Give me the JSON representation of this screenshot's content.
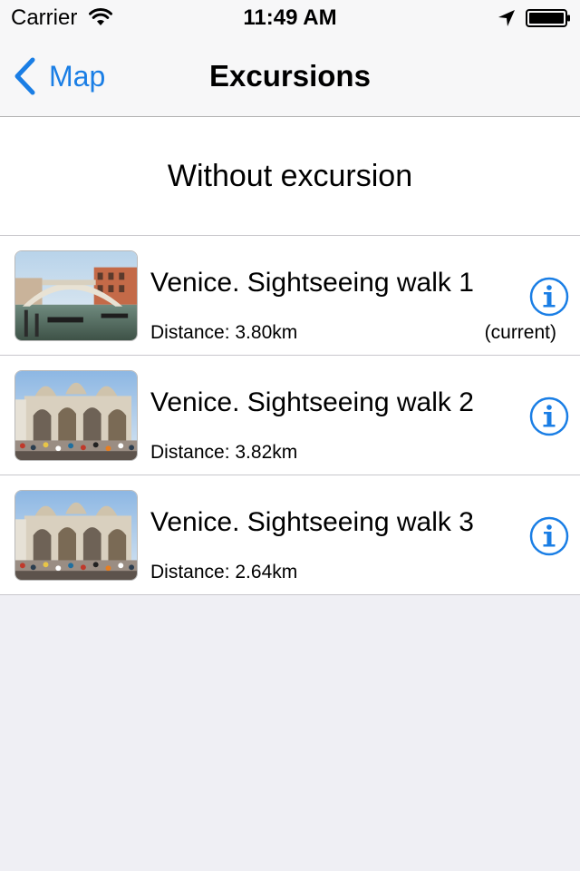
{
  "status_bar": {
    "carrier": "Carrier",
    "time": "11:49 AM"
  },
  "nav": {
    "back_label": "Map",
    "title": "Excursions"
  },
  "list": {
    "without_label": "Without excursion",
    "items": [
      {
        "title": "Venice. Sightseeing walk 1",
        "distance": "Distance: 3.80km",
        "status": "(current)",
        "thumbnail": "rialto-bridge"
      },
      {
        "title": "Venice. Sightseeing walk 2",
        "distance": "Distance: 3.82km",
        "status": "",
        "thumbnail": "st-marks-basilica"
      },
      {
        "title": "Venice. Sightseeing walk 3",
        "distance": "Distance: 2.64km",
        "status": "",
        "thumbnail": "st-marks-basilica"
      }
    ]
  },
  "colors": {
    "accent": "#1a7ee5",
    "bar_background": "#f7f7f8",
    "page_background": "#efeff4",
    "separator": "#c8c7cc"
  },
  "icons": {
    "wifi": "wifi-icon",
    "location": "location-arrow-icon",
    "battery": "battery-icon",
    "back": "chevron-left-icon",
    "info": "info-icon"
  }
}
